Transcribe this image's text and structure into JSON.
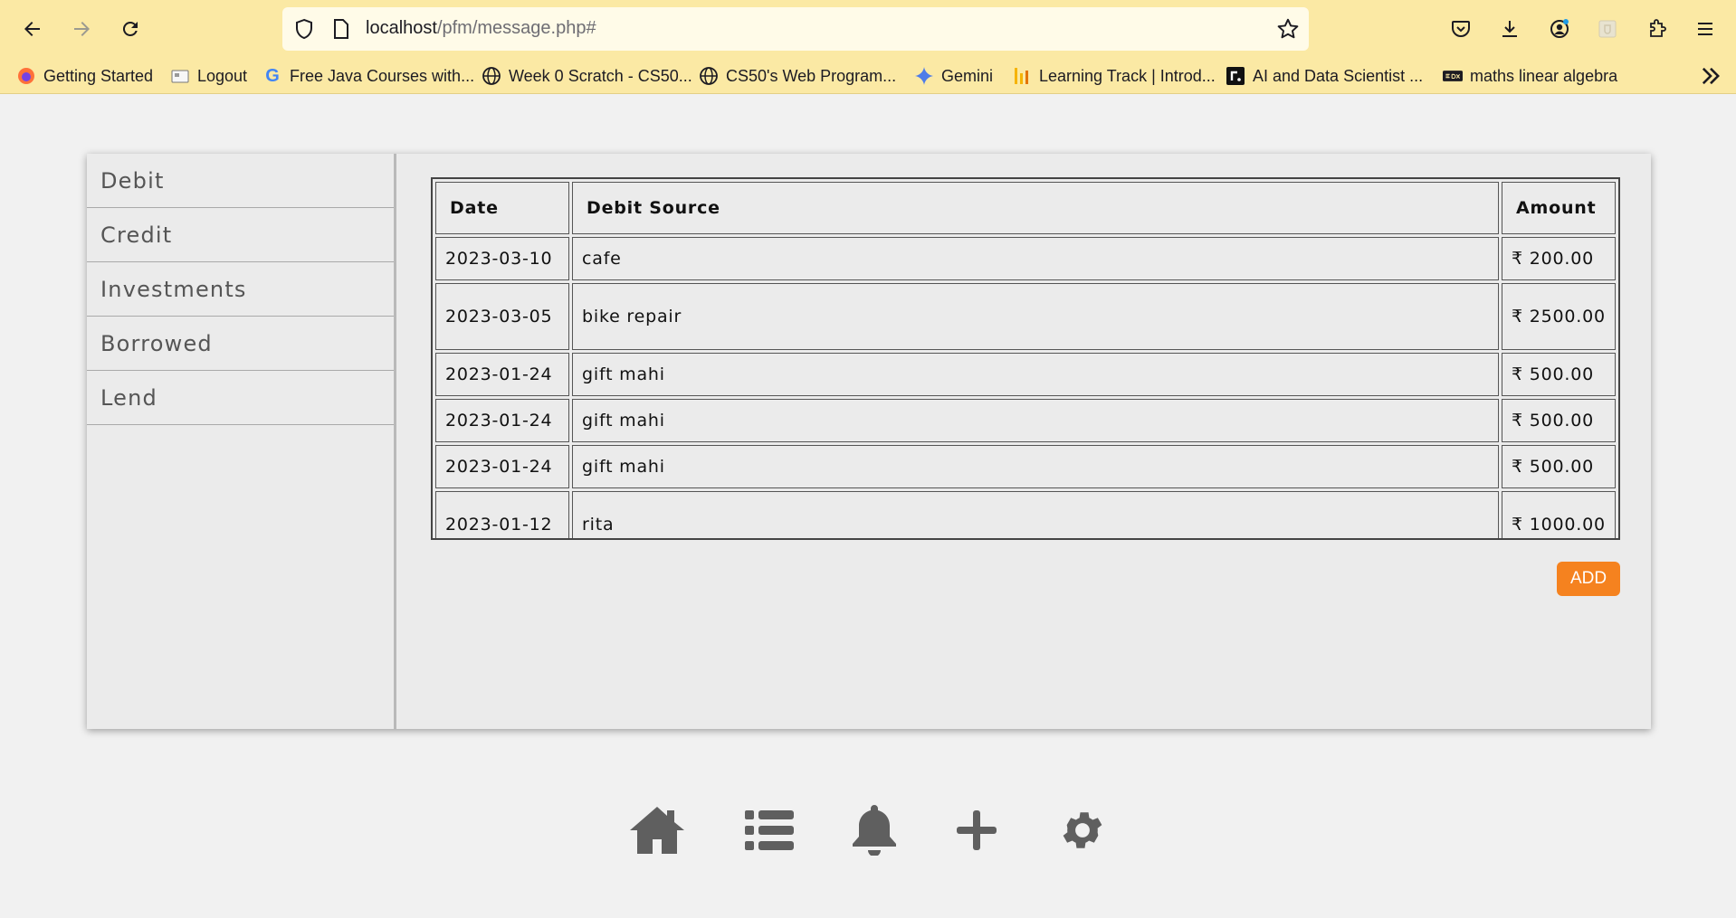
{
  "browser": {
    "url_host": "localhost",
    "url_path": "/pfm/message.php#",
    "bookmarks": [
      {
        "label": "Getting Started",
        "icon": "firefox-icon"
      },
      {
        "label": "Logout",
        "icon": "page-icon"
      },
      {
        "label": "Free Java Courses with...",
        "icon": "google-icon"
      },
      {
        "label": "Week 0 Scratch - CS50...",
        "icon": "globe-icon"
      },
      {
        "label": "CS50's Web Program...",
        "icon": "globe-icon"
      },
      {
        "label": "Gemini",
        "icon": "gemini-icon"
      },
      {
        "label": "Learning Track | Introd...",
        "icon": "chart-icon"
      },
      {
        "label": "AI and Data Scientist ...",
        "icon": "roadmap-icon"
      },
      {
        "label": "maths linear algebra",
        "icon": "edx-icon"
      }
    ]
  },
  "sidebar": {
    "items": [
      {
        "label": "Debit"
      },
      {
        "label": "Credit"
      },
      {
        "label": "Investments"
      },
      {
        "label": "Borrowed"
      },
      {
        "label": "Lend"
      }
    ]
  },
  "table": {
    "headers": [
      "Date",
      "Debit Source",
      "Amount"
    ],
    "rows": [
      {
        "date": "2023-03-10",
        "source": "cafe",
        "amount": "₹ 200.00"
      },
      {
        "date": "2023-03-05",
        "source": "bike repair",
        "amount": "₹ 2500.00"
      },
      {
        "date": "2023-01-24",
        "source": "gift mahi",
        "amount": "₹ 500.00"
      },
      {
        "date": "2023-01-24",
        "source": "gift mahi",
        "amount": "₹ 500.00"
      },
      {
        "date": "2023-01-24",
        "source": "gift mahi",
        "amount": "₹ 500.00"
      },
      {
        "date": "2023-01-12",
        "source": "rita",
        "amount": "₹ 1000.00"
      }
    ]
  },
  "add_button": {
    "label": "ADD"
  },
  "bottom_nav": [
    "home-icon",
    "list-icon",
    "bell-icon",
    "plus-icon",
    "gear-icon"
  ],
  "colors": {
    "accent": "#f5821f",
    "chrome": "#fbe9a4"
  }
}
